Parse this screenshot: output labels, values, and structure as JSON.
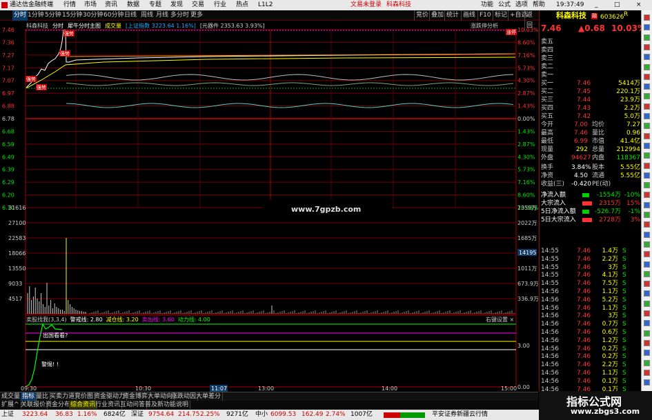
{
  "titlebar": {
    "app": "通达信金融终端",
    "menu": [
      "行情",
      "市场",
      "资讯",
      "数据",
      "专题",
      "发现",
      "交易",
      "行业",
      "热点",
      "L1L2"
    ],
    "trade_status": "文易未登录",
    "stock": "科森科技",
    "right": [
      "功能",
      "公式",
      "选项",
      "帮助"
    ],
    "time": "19:37:49",
    "win": [
      "_",
      "□",
      "×"
    ]
  },
  "periods": [
    "分时",
    "1分钟",
    "5分钟",
    "15分钟",
    "30分钟",
    "60分钟",
    "日线",
    "周线",
    "月线",
    "多分时",
    "更多"
  ],
  "tools": [
    "竞价",
    "叠加",
    "统计",
    "画线",
    "F10",
    "标记",
    "+自选",
    "返回"
  ],
  "chart_header": {
    "name": "科森科技",
    "mode": "分时",
    "main": "犀牛分时主图",
    "vol": "成交量",
    "index": "[上证指数 3223.64 1.16%]",
    "yuanqi": "[元器件 2353.63 3.93%]",
    "analysis": "涨跌停分析"
  },
  "price_axis": {
    "left": [
      "7.46",
      "7.36",
      "7.27",
      "7.17",
      "7.07",
      "6.97",
      "6.88",
      "6.78",
      "6.68",
      "6.59",
      "6.49",
      "6.39",
      "6.29",
      "6.20",
      "6.10"
    ],
    "right": [
      "10.03%",
      "8.60%",
      "7.16%",
      "5.73%",
      "4.30%",
      "2.87%",
      "1.43%",
      "0.00%",
      "1.43%",
      "2.87%",
      "4.30%",
      "5.73%",
      "7.16%",
      "8.60%",
      "10.03%"
    ]
  },
  "vol_axis": {
    "left": [
      "31616",
      "27100",
      "22583",
      "18066",
      "13550",
      "9033",
      "4517"
    ],
    "right": [
      "2359万",
      "2022万",
      "1685万",
      "1348万",
      "1011万",
      "673.9万",
      "336.9万"
    ],
    "marker": "14195"
  },
  "labels": {
    "zt": "涨停",
    "tag1": "强势",
    "tag2": "强势",
    "tag3": "强势",
    "tag4": "强势",
    "watermark": "www.7gpzb.com"
  },
  "indicator": {
    "title": "卖股找我(3,3,4)",
    "a": "警戒线: 2.80",
    "b": "减仓线: 3.20",
    "c": "卖出线: 3.60",
    "d": "动力线: 4.00",
    "setting": "右键设置 ×",
    "t1": "出国看看?",
    "t2": "警惕! !",
    "axis": [
      "3.00",
      "0.00"
    ]
  },
  "time_axis": [
    "09:30",
    "10:30",
    "11:07",
    "13:00",
    "14:00",
    "15:00"
  ],
  "bottomtabs": [
    "成交量",
    "指标",
    "量比",
    "买卖力道",
    "竞价图",
    "资金驱动力",
    "资金博弈",
    "大单动向",
    "涨跌动因",
    "大单差分"
  ],
  "bottomtabs2": [
    "扩展^",
    "关联报价",
    "资金分布",
    "综合资讯",
    "行业资讯",
    "互动问答",
    "普及新功能说明"
  ],
  "quote": {
    "title": "科森科技",
    "tag": "融",
    "code": "603626",
    "r": "R",
    "price": "7.46",
    "change": "▲0.68",
    "pct": "10.03%",
    "asks": [
      [
        "卖五",
        ""
      ],
      [
        "卖四",
        ""
      ],
      [
        "卖三",
        ""
      ],
      [
        "卖二",
        ""
      ],
      [
        "卖一",
        ""
      ]
    ],
    "bids": [
      [
        "买一",
        "7.46",
        "5414万"
      ],
      [
        "买二",
        "7.45",
        "220.1万"
      ],
      [
        "买三",
        "7.44",
        "23.9万"
      ],
      [
        "买四",
        "7.43",
        "2.2万"
      ],
      [
        "买五",
        "7.42",
        "5.0万"
      ]
    ],
    "stats": [
      [
        "今开",
        "7.00",
        "均价",
        "7.27"
      ],
      [
        "最高",
        "7.46",
        "量比",
        "0.96"
      ],
      [
        "最低",
        "6.99",
        "市值",
        "41.4亿"
      ],
      [
        "现量",
        "292",
        "总量",
        "212994"
      ],
      [
        "外盘",
        "94627",
        "内盘",
        "118367"
      ],
      [
        "换手",
        "3.84%",
        "股本",
        "5.55亿"
      ],
      [
        "净资",
        "4.50",
        "流通",
        "5.55亿"
      ],
      [
        "收益(三)",
        "-0.420",
        "PE(动)",
        ""
      ]
    ],
    "flow": [
      [
        "净流入额",
        "-1554万",
        "-10%"
      ],
      [
        "大宗流入",
        "2315万",
        "15%"
      ],
      [
        "5日净流入额",
        "-526.7万",
        "-1%"
      ],
      [
        "5日大宗流入",
        "2728万",
        "3%"
      ]
    ],
    "ticks": [
      [
        "14:55",
        "7.46",
        "1.4万",
        "S"
      ],
      [
        "14:55",
        "7.46",
        "2.2万",
        "S"
      ],
      [
        "14:55",
        "7.46",
        "3万",
        "S"
      ],
      [
        "14:55",
        "7.46",
        "4.1万",
        "S"
      ],
      [
        "14:55",
        "7.46",
        "7.5万",
        "S"
      ],
      [
        "14:56",
        "7.46",
        "1.1万",
        "S"
      ],
      [
        "14:56",
        "7.46",
        "5.2万",
        "S"
      ],
      [
        "14:56",
        "7.46",
        "1.1万",
        "S"
      ],
      [
        "14:56",
        "7.46",
        "3万",
        "S"
      ],
      [
        "14:56",
        "7.46",
        "0.7万",
        "S"
      ],
      [
        "14:56",
        "7.46",
        "0.6万",
        "S"
      ],
      [
        "14:56",
        "7.46",
        "1.2万",
        "S"
      ],
      [
        "14:56",
        "7.46",
        "0.2万",
        "S"
      ],
      [
        "14:56",
        "7.46",
        "0.2万",
        "S"
      ],
      [
        "14:56",
        "7.46",
        "2.2万",
        "S"
      ],
      [
        "14:56",
        "7.46",
        "1.1万",
        "S"
      ],
      [
        "14:56",
        "7.46",
        "0.1万",
        "S"
      ],
      [
        "14:56",
        "7.46",
        "0.1万",
        "S"
      ],
      [
        "14:56",
        "7.46",
        "0.1万",
        "S"
      ],
      [
        "14:56",
        "7.46",
        "0.2万",
        "S"
      ],
      [
        "14:56",
        "7.46",
        "0.1万",
        "S"
      ]
    ],
    "foot": [
      "图文F10",
      "副选板"
    ]
  },
  "status": {
    "sh": "上证",
    "sh_v": "3223.64",
    "sh_c": "36.83",
    "sh_p": "1.16%",
    "sh_a": "6824亿",
    "sz": "深证",
    "sz_v": "9754.64",
    "sz_c": "214.75",
    "sz_p": "2.25%",
    "sz_a": "9271亿",
    "zx": "中小",
    "zx_v": "6099.53",
    "zx_c": "162.49",
    "zx_p": "2.74%",
    "zx_a": "1007亿",
    "broker": "平安证券新疆云行情"
  },
  "logo": {
    "t1": "指标公式网",
    "t2": "www.zbgs3.com"
  }
}
